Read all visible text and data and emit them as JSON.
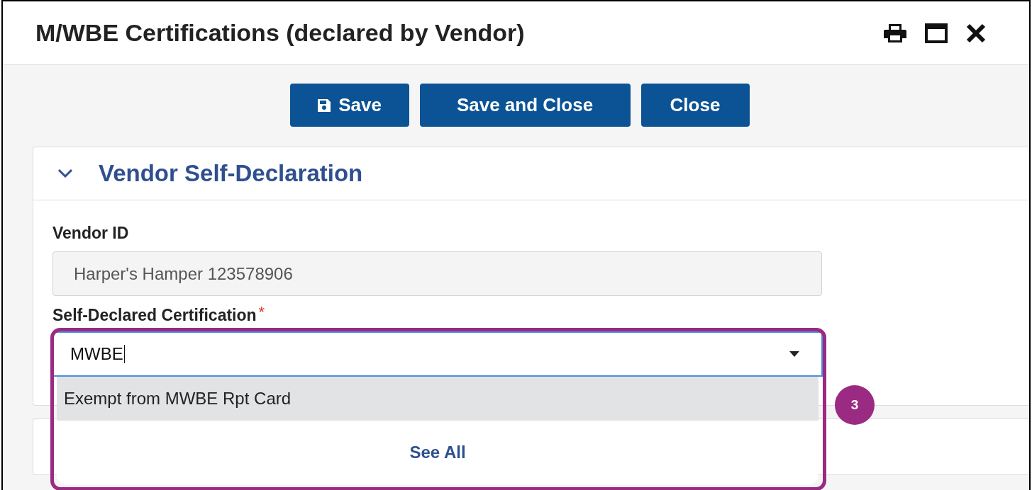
{
  "window": {
    "title": "M/WBE Certifications (declared by Vendor)"
  },
  "buttons": [
    {
      "label": "Save",
      "kind": "save"
    },
    {
      "label": "Save and Close",
      "kind": "plain"
    },
    {
      "label": "Close",
      "kind": "plain"
    }
  ],
  "section": {
    "title": "Vendor Self-Declaration",
    "expanded": true
  },
  "vendor_id": {
    "label": "Vendor ID",
    "value": "Harper's Hamper 123578906",
    "disabled": true
  },
  "certification": {
    "label": "Self-Declared Certification",
    "required_mark": "*",
    "value": "MWBE",
    "expanded": true,
    "options": [
      {
        "label": "Exempt from MWBE Rpt Card",
        "selected": true
      }
    ],
    "see_all": "See All"
  },
  "callout": {
    "number": "3"
  }
}
